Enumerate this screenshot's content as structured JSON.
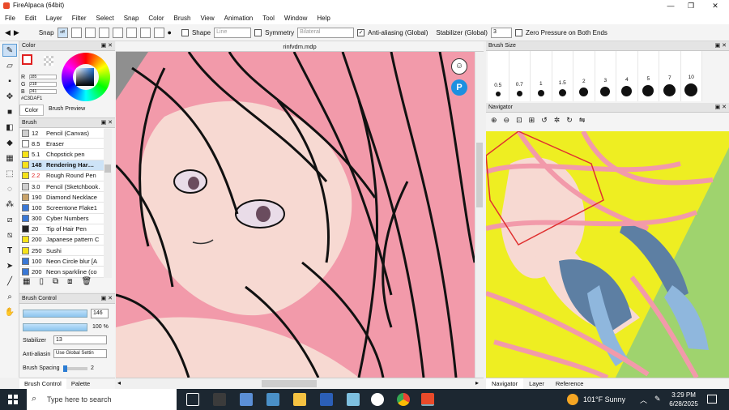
{
  "window": {
    "title": "FireAlpaca (64bit)",
    "min": "—",
    "max": "❐",
    "close": "✕"
  },
  "menu": [
    "File",
    "Edit",
    "Layer",
    "Filter",
    "Select",
    "Snap",
    "Color",
    "Brush",
    "View",
    "Animation",
    "Tool",
    "Window",
    "Help"
  ],
  "toolbar": {
    "snap_label": "Snap",
    "snap_off": "off",
    "shape_label": "Shape",
    "shape_value": "Line",
    "symmetry_label": "Symmetry",
    "symmetry_value": "Bilateral",
    "antialias_label": "Anti-aliasing (Global)",
    "stabilizer_label": "Stabilizer (Global)",
    "stabilizer_value": "3",
    "zero_pressure_label": "Zero Pressure on Both Ends"
  },
  "color_panel": {
    "title": "Color",
    "r_label": "R",
    "r": "185",
    "g_label": "G",
    "g": "218",
    "b_label": "B",
    "b": "241",
    "hex": "#C3DAF1",
    "tab_color": "Color",
    "tab_preview": "Brush Preview"
  },
  "brush_panel": {
    "title": "Brush",
    "items": [
      {
        "size": "12",
        "name": "Pencil (Canvas)",
        "color": "#cfcfcf"
      },
      {
        "size": "8.5",
        "name": "Eraser",
        "color": "#ffffff"
      },
      {
        "size": "5.1",
        "name": "Chopstick pen",
        "color": "#f5e21a"
      },
      {
        "size": "148",
        "name": "Rendering Har…",
        "color": "#f5e21a"
      },
      {
        "size": "2.2",
        "name": "Rough Round Pen",
        "color": "#f5e21a"
      },
      {
        "size": "3.0",
        "name": "Pencil (Sketchbook…",
        "color": "#cfcfcf"
      },
      {
        "size": "190",
        "name": "Diamond Necklace",
        "color": "#c9a36a"
      },
      {
        "size": "100",
        "name": "Screentone Flake1",
        "color": "#3a78d6"
      },
      {
        "size": "300",
        "name": "Cyber Numbers",
        "color": "#3a78d6"
      },
      {
        "size": "20",
        "name": "Tip of Hair Pen",
        "color": "#222222"
      },
      {
        "size": "200",
        "name": "Japanese pattern C",
        "color": "#f5e21a"
      },
      {
        "size": "250",
        "name": "Sushi",
        "color": "#f5e21a"
      },
      {
        "size": "100",
        "name": "Neon Circle blur [A",
        "color": "#3a78d6"
      },
      {
        "size": "200",
        "name": "Neon sparkline (co",
        "color": "#3a78d6"
      }
    ]
  },
  "brush_control": {
    "title": "Brush Control",
    "size_value": "146",
    "opacity_value": "100 %",
    "stabilizer_label": "Stabilizer",
    "stabilizer_value": "13",
    "antialias_label": "Anti-aliasin",
    "antialias_value": "Use Global Settin",
    "spacing_label": "Brush Spacing",
    "spacing_value": "2",
    "tab_control": "Brush Control",
    "tab_palette": "Palette"
  },
  "canvas": {
    "filename": "rinfvdm.mdp"
  },
  "brush_size": {
    "title": "Brush Size",
    "sizes": [
      "0.5",
      "0.7",
      "1",
      "1.5",
      "2",
      "3",
      "4",
      "5",
      "7",
      "10"
    ]
  },
  "navigator": {
    "title": "Navigator",
    "tab_navigator": "Navigator",
    "tab_layer": "Layer",
    "tab_reference": "Reference"
  },
  "taskbar": {
    "search_placeholder": "Type here to search",
    "weather": "101°F  Sunny",
    "time": "3:29 PM",
    "date": "6/28/2025"
  }
}
